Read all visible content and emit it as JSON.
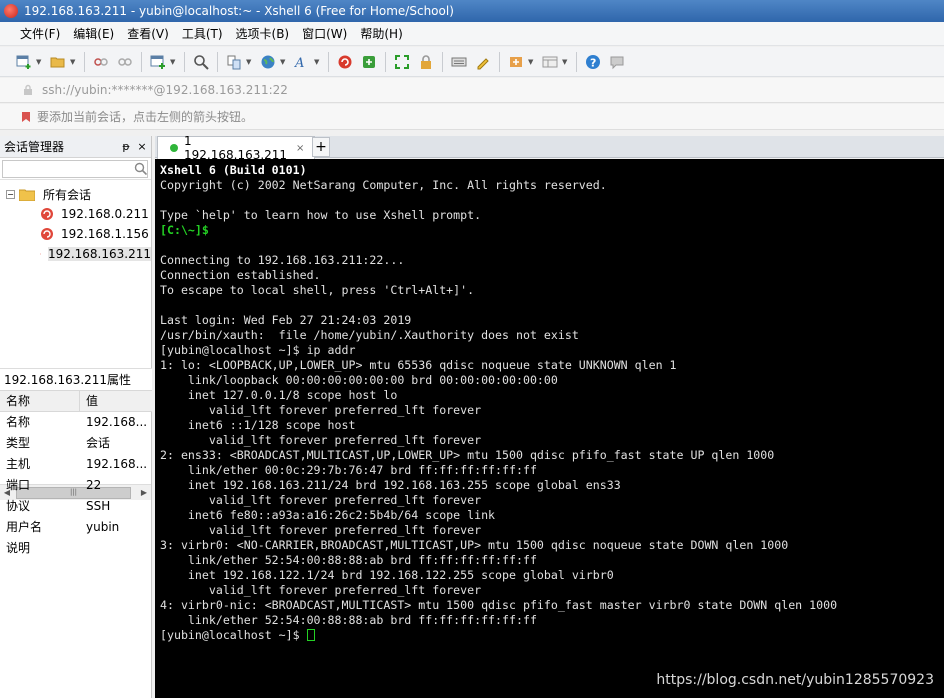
{
  "window": {
    "title": "192.168.163.211 - yubin@localhost:~ - Xshell 6 (Free for Home/School)"
  },
  "menu": [
    "文件(F)",
    "编辑(E)",
    "查看(V)",
    "工具(T)",
    "选项卡(B)",
    "窗口(W)",
    "帮助(H)"
  ],
  "toolbar": {
    "icons": [
      "new-session-icon",
      "open-folder-icon",
      "disconnect-icon",
      "reconnect-icon",
      "new-window-icon",
      "find-icon",
      "transfer-icon",
      "globe-icon",
      "font-icon",
      "xshell-icon",
      "xftp-icon",
      "fullscreen-icon",
      "lock-icon",
      "keyboard-icon",
      "highlight-icon",
      "compose-icon",
      "layout-icon",
      "help-icon",
      "chat-icon"
    ]
  },
  "address": {
    "text": "ssh://yubin:*******@192.168.163.211:22"
  },
  "hint": {
    "text": "要添加当前会话，点击左侧的箭头按钮。"
  },
  "session_panel": {
    "title": "会话管理器",
    "pin": "ᵽ",
    "close": "×",
    "root_folder": "所有会话",
    "sessions": [
      "192.168.0.211",
      "192.168.1.156",
      "192.168.163.211"
    ]
  },
  "properties": {
    "title": "192.168.163.211属性",
    "col_name": "名称",
    "col_value": "值",
    "rows": [
      {
        "k": "名称",
        "v": "192.168..."
      },
      {
        "k": "类型",
        "v": "会话"
      },
      {
        "k": "主机",
        "v": "192.168..."
      },
      {
        "k": "端口",
        "v": "22"
      },
      {
        "k": "协议",
        "v": "SSH"
      },
      {
        "k": "用户名",
        "v": "yubin"
      },
      {
        "k": "说明",
        "v": ""
      }
    ]
  },
  "tabs": {
    "active_label": "1 192.168.163.211",
    "close": "×",
    "new": "+"
  },
  "terminal": {
    "lines": [
      {
        "t": "Xshell 6 (Build 0101)",
        "s": "bold"
      },
      {
        "t": "Copyright (c) 2002 NetSarang Computer, Inc. All rights reserved.",
        "s": ""
      },
      {
        "t": "",
        "s": ""
      },
      {
        "t": "Type `help' to learn how to use Xshell prompt.",
        "s": ""
      },
      {
        "t": "[C:\\~]$",
        "s": "prompt-green"
      },
      {
        "t": "",
        "s": ""
      },
      {
        "t": "Connecting to 192.168.163.211:22...",
        "s": ""
      },
      {
        "t": "Connection established.",
        "s": ""
      },
      {
        "t": "To escape to local shell, press 'Ctrl+Alt+]'.",
        "s": ""
      },
      {
        "t": "",
        "s": ""
      },
      {
        "t": "Last login: Wed Feb 27 21:24:03 2019",
        "s": ""
      },
      {
        "t": "/usr/bin/xauth:  file /home/yubin/.Xauthority does not exist",
        "s": ""
      },
      {
        "t": "[yubin@localhost ~]$ ip addr",
        "s": ""
      },
      {
        "t": "1: lo: <LOOPBACK,UP,LOWER_UP> mtu 65536 qdisc noqueue state UNKNOWN qlen 1",
        "s": ""
      },
      {
        "t": "    link/loopback 00:00:00:00:00:00 brd 00:00:00:00:00:00",
        "s": ""
      },
      {
        "t": "    inet 127.0.0.1/8 scope host lo",
        "s": ""
      },
      {
        "t": "       valid_lft forever preferred_lft forever",
        "s": ""
      },
      {
        "t": "    inet6 ::1/128 scope host",
        "s": ""
      },
      {
        "t": "       valid_lft forever preferred_lft forever",
        "s": ""
      },
      {
        "t": "2: ens33: <BROADCAST,MULTICAST,UP,LOWER_UP> mtu 1500 qdisc pfifo_fast state UP qlen 1000",
        "s": ""
      },
      {
        "t": "    link/ether 00:0c:29:7b:76:47 brd ff:ff:ff:ff:ff:ff",
        "s": ""
      },
      {
        "t": "    inet 192.168.163.211/24 brd 192.168.163.255 scope global ens33",
        "s": ""
      },
      {
        "t": "       valid_lft forever preferred_lft forever",
        "s": ""
      },
      {
        "t": "    inet6 fe80::a93a:a16:26c2:5b4b/64 scope link",
        "s": ""
      },
      {
        "t": "       valid_lft forever preferred_lft forever",
        "s": ""
      },
      {
        "t": "3: virbr0: <NO-CARRIER,BROADCAST,MULTICAST,UP> mtu 1500 qdisc noqueue state DOWN qlen 1000",
        "s": ""
      },
      {
        "t": "    link/ether 52:54:00:88:88:ab brd ff:ff:ff:ff:ff:ff",
        "s": ""
      },
      {
        "t": "    inet 192.168.122.1/24 brd 192.168.122.255 scope global virbr0",
        "s": ""
      },
      {
        "t": "       valid_lft forever preferred_lft forever",
        "s": ""
      },
      {
        "t": "4: virbr0-nic: <BROADCAST,MULTICAST> mtu 1500 qdisc pfifo_fast master virbr0 state DOWN qlen 1000",
        "s": ""
      },
      {
        "t": "    link/ether 52:54:00:88:88:ab brd ff:ff:ff:ff:ff:ff",
        "s": ""
      }
    ],
    "final_prompt": "[yubin@localhost ~]$ ",
    "watermark": "https://blog.csdn.net/yubin1285570923"
  },
  "colors": {
    "terminal_bg": "#000000",
    "prompt_green": "#24d024",
    "titlebar": "#2f66ab",
    "status_dot": "#2fb53a"
  }
}
